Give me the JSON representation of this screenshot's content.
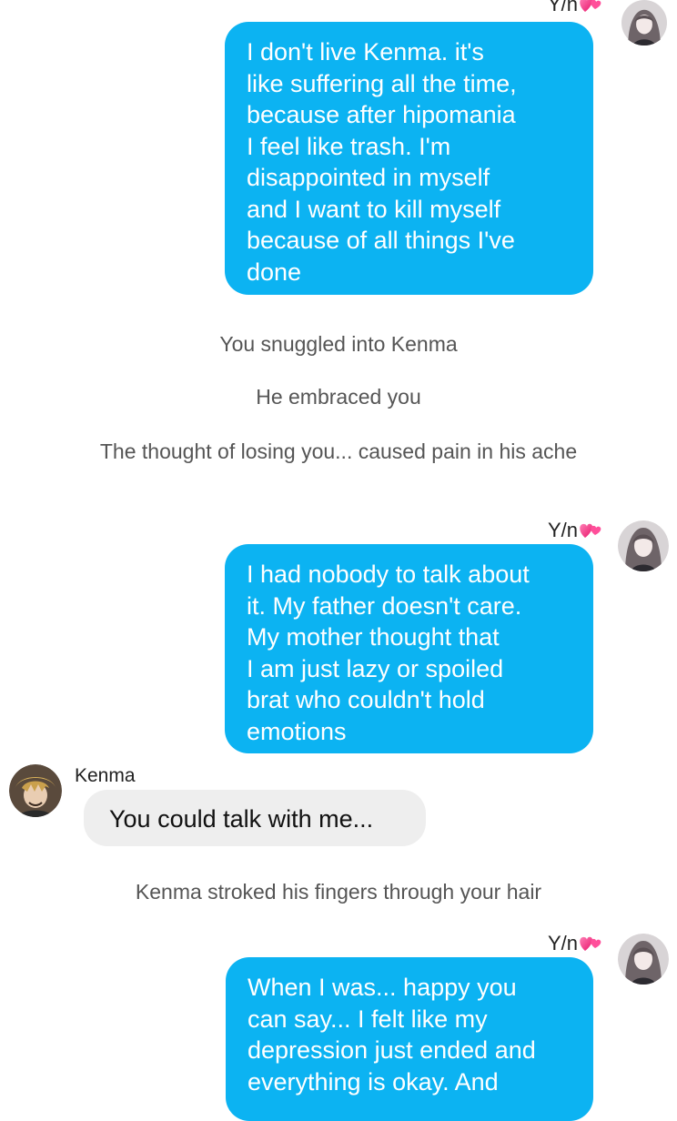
{
  "colors": {
    "my_bubble": "#0cb3f2",
    "other_bubble": "#eeeeee",
    "narration_text": "#555555",
    "heart_accent": "#ff3d8e"
  },
  "messages": [
    {
      "type": "outgoing",
      "sender": "Y/n",
      "sender_emoji": "pink-hearts-icon",
      "text": "I don't live Kenma. it's\nlike suffering all the time,\nbecause after hipomania\nI feel like trash. I'm\ndisappointed in myself\nand I want to kill myself\nbecause of all things I've\ndone"
    },
    {
      "type": "narration",
      "text": "You snuggled into Kenma"
    },
    {
      "type": "narration",
      "text": "He embraced you"
    },
    {
      "type": "narration",
      "text": "The thought of losing you... caused pain in his ache"
    },
    {
      "type": "outgoing",
      "sender": "Y/n",
      "sender_emoji": "pink-hearts-icon",
      "text": "I had nobody to talk about\nit. My father doesn't care.\nMy mother thought that\nI am just lazy or spoiled\nbrat  who couldn't hold\nemotions"
    },
    {
      "type": "incoming",
      "sender": "Kenma",
      "text": "You could talk with me..."
    },
    {
      "type": "narration",
      "text": "Kenma stroked his fingers through your hair"
    },
    {
      "type": "outgoing",
      "sender": "Y/n",
      "sender_emoji": "pink-hearts-icon",
      "text": "When I was... happy you\ncan say... I felt like my\ndepression just ended and\neverything is okay. And"
    }
  ]
}
